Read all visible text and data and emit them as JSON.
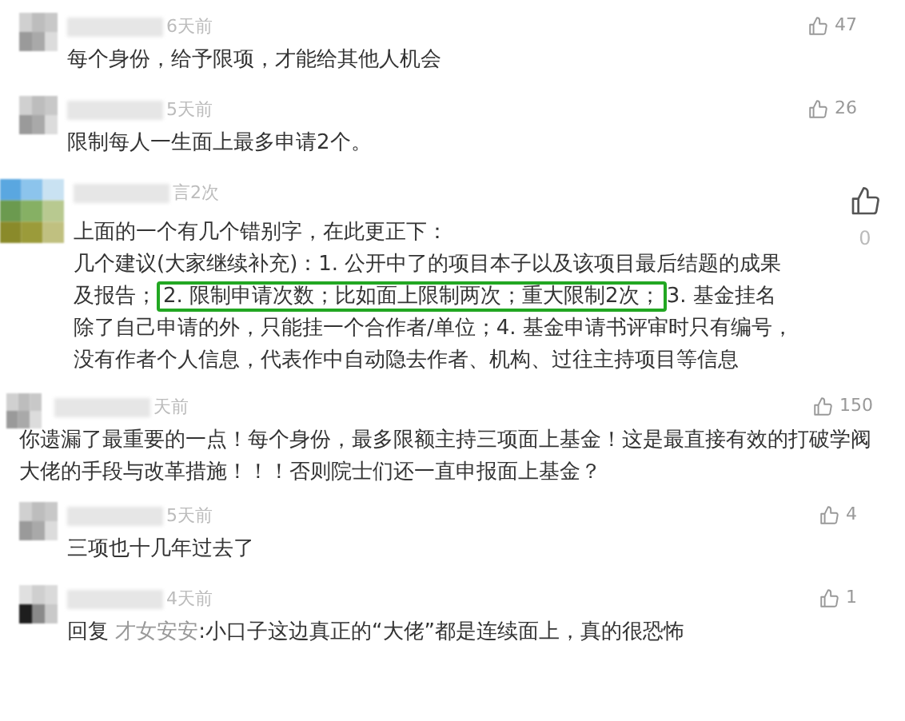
{
  "comments": [
    {
      "kind": "reply",
      "time": "6天前",
      "likes": "47",
      "big_like": false,
      "paragraphs": [
        [
          {
            "text": "每个身份，给予限项，才能给其他人机会",
            "highlighted": false
          }
        ]
      ]
    },
    {
      "kind": "reply",
      "time": "5天前",
      "likes": "26",
      "big_like": false,
      "paragraphs": [
        [
          {
            "text": "限制每人一生面上最多申请2个。",
            "highlighted": false
          }
        ]
      ]
    },
    {
      "kind": "main",
      "time": "言2次",
      "likes": "0",
      "big_like": true,
      "paragraphs": [
        [
          {
            "text": "上面的一个有几个错别字，在此更正下：",
            "highlighted": false
          }
        ],
        [
          {
            "text": "几个建议(大家继续补充)：1. 公开中了的项目本子以及该项目最后结题的成果及报告；",
            "highlighted": false
          },
          {
            "text": "2. 限制申请次数；比如面上限制两次；重大限制2次；",
            "highlighted": true
          },
          {
            "text": "3. 基金挂名除了自己申请的外，只能挂一个合作者/单位；4. 基金申请书评审时只有编号，没有作者个人信息，代表作中自动隐去作者、机构、过往主持项目等信息",
            "highlighted": false
          }
        ]
      ]
    },
    {
      "kind": "main",
      "time": "天前",
      "likes": "150",
      "big_like": false,
      "paragraphs": [
        [
          {
            "text": "你遗漏了最重要的一点！每个身份，最多限额主持三项面上基金！这是最直接有效的打破学阀大佬的手段与改革措施！！！否则院士们还一直申报面上基金？",
            "highlighted": false
          }
        ]
      ]
    },
    {
      "kind": "reply",
      "time": "5天前",
      "likes": "4",
      "big_like": false,
      "paragraphs": [
        [
          {
            "text": "三项也十几年过去了",
            "highlighted": false
          }
        ]
      ]
    },
    {
      "kind": "reply",
      "time": "4天前",
      "likes": "1",
      "big_like": false,
      "reply_prefix": "回复",
      "reply_to": "才女安安",
      "paragraphs": [
        [
          {
            "text": ":小口子这边真正的“大佬”都是连续面上，真的很恐怖",
            "highlighted": false
          }
        ]
      ]
    }
  ]
}
